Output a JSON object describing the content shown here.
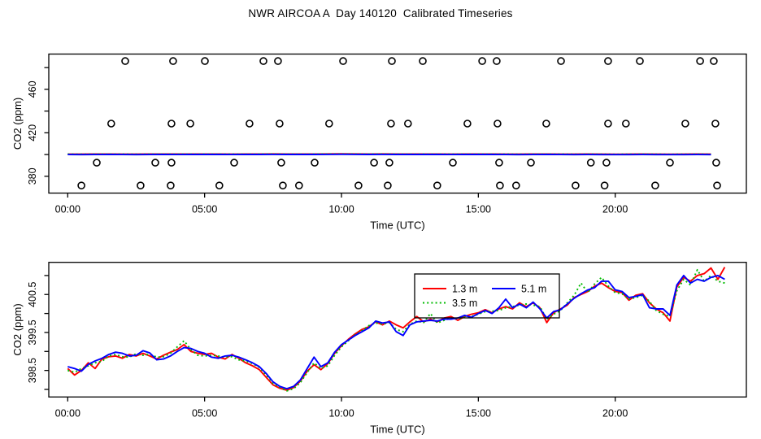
{
  "title": "NWR AIRCOA A  Day 140120  Calibrated Timeseries",
  "colors": {
    "red": "#ff0000",
    "green": "#00bb00",
    "blue": "#0000ff",
    "axis": "#000000",
    "bg": "#ffffff"
  },
  "axes": {
    "x_label": "Time (UTC)",
    "y_label": "CO2 (ppm)",
    "x_tick_labels": [
      "00:00",
      "05:00",
      "10:00",
      "15:00",
      "20:00"
    ],
    "x_tick_hours": [
      0,
      5,
      10,
      15,
      20
    ]
  },
  "legend": {
    "entries": [
      {
        "label": "1.3 m",
        "color": "red",
        "dash": "solid"
      },
      {
        "label": "3.5 m",
        "color": "green",
        "dash": "dotted"
      },
      {
        "label": "5.1 m",
        "color": "blue",
        "dash": "solid"
      }
    ]
  },
  "chart_data": [
    {
      "type": "line",
      "panel": "top",
      "title": "",
      "xlabel": "Time (UTC)",
      "ylabel": "CO2 (ppm)",
      "xlim_hours": [
        0,
        25
      ],
      "ylim": [
        365,
        495
      ],
      "yticks": [
        380,
        400,
        420,
        440,
        460,
        480
      ],
      "ytick_labeled": [
        380,
        420,
        460
      ],
      "calibration_circles": [
        {
          "ppm": 486.0,
          "hours": [
            2.1,
            3.85,
            5.01,
            7.15,
            7.68,
            10.06,
            11.84,
            12.97,
            15.14,
            15.67,
            18.02,
            19.74,
            20.9,
            23.1,
            23.6
          ]
        },
        {
          "ppm": 428.5,
          "hours": [
            1.59,
            3.79,
            4.48,
            6.64,
            7.74,
            9.55,
            11.81,
            12.43,
            14.6,
            15.7,
            17.48,
            19.74,
            20.39,
            22.56,
            23.66
          ]
        },
        {
          "ppm": 392.5,
          "hours": [
            1.06,
            3.2,
            3.79,
            6.08,
            7.8,
            9.02,
            11.19,
            11.75,
            14.07,
            15.76,
            16.92,
            19.11,
            19.68,
            22.0,
            23.69
          ]
        },
        {
          "ppm": 371.5,
          "hours": [
            0.5,
            2.66,
            3.76,
            5.54,
            7.86,
            8.45,
            10.62,
            11.69,
            13.5,
            15.79,
            16.38,
            18.55,
            19.61,
            21.46,
            23.72
          ]
        }
      ],
      "series": [
        {
          "name": "1.3 m",
          "color": "red",
          "dash": "solid",
          "start_hour": 0,
          "step_hours": 0.5,
          "values": [
            400.4,
            400.35,
            400.45,
            400.5,
            400.4,
            400.35,
            400.45,
            400.5,
            400.45,
            400.5,
            400.55,
            400.5,
            400.4,
            400.5,
            400.55,
            400.6,
            400.5,
            400.45,
            400.55,
            400.6,
            400.65,
            400.6,
            400.5,
            400.6,
            400.55,
            400.45,
            400.55,
            400.5,
            400.4,
            400.5,
            400.55,
            400.5,
            400.4,
            400.35,
            400.45,
            400.5,
            400.4,
            400.35,
            400.45,
            400.4,
            400.3,
            400.4,
            400.45,
            400.4,
            400.3,
            400.4,
            400.45,
            400.4
          ]
        },
        {
          "name": "3.5 m",
          "color": "green",
          "dash": "dotted",
          "start_hour": 0,
          "step_hours": 0.5,
          "values": [
            400.35,
            400.3,
            400.35,
            400.4,
            400.35,
            400.3,
            400.35,
            400.4,
            400.35,
            400.4,
            400.45,
            400.4,
            400.35,
            400.4,
            400.45,
            400.5,
            400.45,
            400.4,
            400.45,
            400.5,
            400.55,
            400.5,
            400.45,
            400.5,
            400.45,
            400.4,
            400.45,
            400.4,
            400.35,
            400.4,
            400.45,
            400.4,
            400.35,
            400.3,
            400.35,
            400.4,
            400.35,
            400.3,
            400.35,
            400.3,
            400.25,
            400.3,
            400.35,
            400.3,
            400.25,
            400.3,
            400.35,
            400.3
          ]
        },
        {
          "name": "5.1 m",
          "color": "blue",
          "dash": "solid",
          "start_hour": 0,
          "step_hours": 0.5,
          "values": [
            400.0,
            399.95,
            400.0,
            400.05,
            400.0,
            399.95,
            400.0,
            400.05,
            400.0,
            400.05,
            400.1,
            400.05,
            400.0,
            400.05,
            400.1,
            400.15,
            400.1,
            400.05,
            400.1,
            400.15,
            400.2,
            400.15,
            400.1,
            400.15,
            400.1,
            400.05,
            400.1,
            400.05,
            400.0,
            400.05,
            400.1,
            400.05,
            400.0,
            399.95,
            400.0,
            400.05,
            400.0,
            399.95,
            400.0,
            399.95,
            399.9,
            399.95,
            400.0,
            399.95,
            399.9,
            399.95,
            400.0,
            399.95
          ]
        }
      ]
    },
    {
      "type": "line",
      "panel": "bottom",
      "title": "",
      "xlabel": "Time (UTC)",
      "ylabel": "CO2 (ppm)",
      "xlim_hours": [
        0,
        25
      ],
      "ylim": [
        397.9,
        401.4
      ],
      "yticks": [
        398,
        398.5,
        399,
        399.5,
        400,
        400.5,
        401
      ],
      "ytick_labeled": [
        398.5,
        399.5,
        400.5
      ],
      "legend_position": "top-center",
      "series": [
        {
          "name": "1.3 m",
          "color": "red",
          "dash": "solid",
          "start_hour": 0,
          "step_hours": 0.25,
          "values": [
            398.55,
            398.38,
            398.5,
            398.7,
            398.55,
            398.8,
            398.86,
            398.88,
            398.82,
            398.92,
            398.88,
            398.95,
            398.88,
            398.8,
            398.9,
            398.98,
            399.05,
            399.18,
            399.0,
            398.95,
            398.92,
            398.95,
            398.85,
            398.8,
            398.92,
            398.82,
            398.7,
            398.62,
            398.52,
            398.32,
            398.12,
            398.03,
            397.98,
            398.05,
            398.22,
            398.48,
            398.65,
            398.52,
            398.68,
            398.95,
            399.15,
            399.32,
            399.46,
            399.58,
            399.65,
            399.78,
            399.7,
            399.8,
            399.7,
            399.62,
            399.78,
            399.92,
            399.78,
            399.85,
            399.78,
            399.88,
            399.92,
            399.82,
            399.92,
            399.98,
            400.02,
            400.1,
            400.02,
            400.12,
            400.18,
            400.12,
            400.28,
            400.18,
            400.28,
            400.15,
            399.76,
            400.02,
            400.12,
            400.22,
            400.42,
            400.5,
            400.58,
            400.72,
            400.8,
            400.68,
            400.58,
            400.55,
            400.35,
            400.48,
            400.52,
            400.28,
            400.12,
            400.02,
            399.8,
            400.7,
            400.95,
            400.85,
            401.0,
            401.05,
            401.2,
            400.9,
            401.22
          ]
        },
        {
          "name": "3.5 m",
          "color": "green",
          "dash": "dotted",
          "start_hour": 0,
          "step_hours": 0.25,
          "values": [
            398.5,
            398.45,
            398.55,
            398.62,
            398.7,
            398.74,
            398.88,
            398.92,
            398.86,
            398.85,
            398.94,
            398.9,
            398.93,
            398.85,
            398.86,
            398.95,
            399.12,
            399.28,
            399.05,
            398.9,
            398.88,
            398.9,
            398.88,
            398.85,
            398.86,
            398.78,
            398.75,
            398.68,
            398.58,
            398.38,
            398.16,
            398.05,
            397.96,
            398.02,
            398.18,
            398.45,
            398.7,
            398.55,
            398.62,
            398.9,
            399.12,
            399.28,
            399.44,
            399.55,
            399.68,
            399.75,
            399.72,
            399.76,
            399.58,
            399.52,
            399.72,
            399.8,
            399.76,
            400.0,
            399.75,
            399.82,
            399.88,
            399.86,
            399.9,
            399.92,
            399.98,
            400.05,
            400.06,
            400.08,
            400.15,
            400.18,
            400.22,
            400.25,
            400.22,
            400.18,
            399.85,
            399.98,
            400.08,
            400.28,
            400.48,
            400.8,
            400.55,
            400.78,
            400.95,
            400.72,
            400.55,
            400.52,
            400.38,
            400.42,
            400.48,
            400.32,
            400.08,
            399.98,
            399.92,
            400.6,
            400.9,
            400.75,
            401.15,
            400.85,
            401.0,
            400.85,
            400.8
          ]
        },
        {
          "name": "5.1 m",
          "color": "blue",
          "dash": "solid",
          "start_hour": 0,
          "step_hours": 0.25,
          "values": [
            398.6,
            398.55,
            398.48,
            398.66,
            398.75,
            398.82,
            398.92,
            398.98,
            398.95,
            398.88,
            398.9,
            399.02,
            398.96,
            398.78,
            398.8,
            398.88,
            399.0,
            399.1,
            399.08,
            399.0,
            398.95,
            398.85,
            398.82,
            398.88,
            398.9,
            398.85,
            398.78,
            398.7,
            398.6,
            398.42,
            398.2,
            398.08,
            398.02,
            398.08,
            398.25,
            398.55,
            398.85,
            398.6,
            398.7,
            398.98,
            399.18,
            399.3,
            399.42,
            399.52,
            399.62,
            399.8,
            399.75,
            399.78,
            399.52,
            399.42,
            399.7,
            399.78,
            399.8,
            399.82,
            399.8,
            399.85,
            399.85,
            399.88,
            399.95,
            399.9,
            400.0,
            400.08,
            400.0,
            400.15,
            400.38,
            400.15,
            400.25,
            400.15,
            400.3,
            400.12,
            399.88,
            400.05,
            400.1,
            400.25,
            400.4,
            400.52,
            400.62,
            400.68,
            400.85,
            400.85,
            400.62,
            400.58,
            400.42,
            400.45,
            400.5,
            400.15,
            400.12,
            400.12,
            399.95,
            400.75,
            401.0,
            400.8,
            400.9,
            400.85,
            400.95,
            401.0,
            400.9
          ]
        }
      ]
    }
  ]
}
